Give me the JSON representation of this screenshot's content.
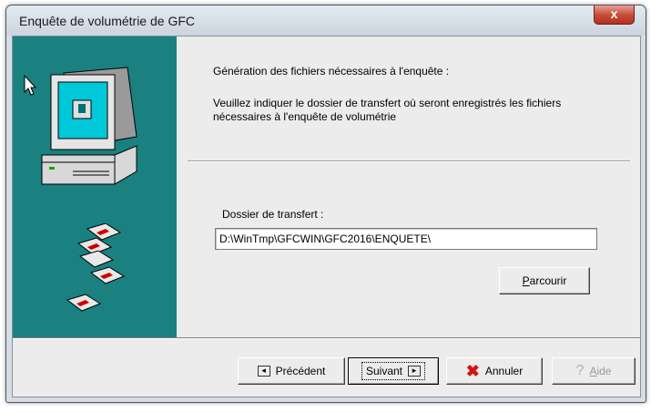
{
  "window": {
    "title": "Enquête de volumétrie de GFC",
    "close_glyph": "x"
  },
  "content": {
    "heading": "Génération des fichiers nécessaires à l'enquête :",
    "description": "Veuillez indiquer le dossier de transfert où seront enregistrés les fichiers nécessaires à l'enquête de volumétrie",
    "folder_label": "Dossier de transfert :",
    "folder_value": "D:\\WinTmp\\GFCWIN\\GFC2016\\ENQUETE\\",
    "browse_label_first": "P",
    "browse_label_rest": "arcourir"
  },
  "buttons": {
    "previous": "Précédent",
    "next": "Suivant",
    "cancel": "Annuler",
    "help_first": "A",
    "help_rest": "ide"
  },
  "colors": {
    "sidebar": "#1a8080",
    "cancel_icon": "#d11414"
  },
  "icons": [
    "cursor-arrow-icon",
    "computer-icon",
    "floppy-disks-icon",
    "previous-arrow-icon",
    "next-arrow-icon",
    "cancel-x-icon",
    "help-icon"
  ]
}
